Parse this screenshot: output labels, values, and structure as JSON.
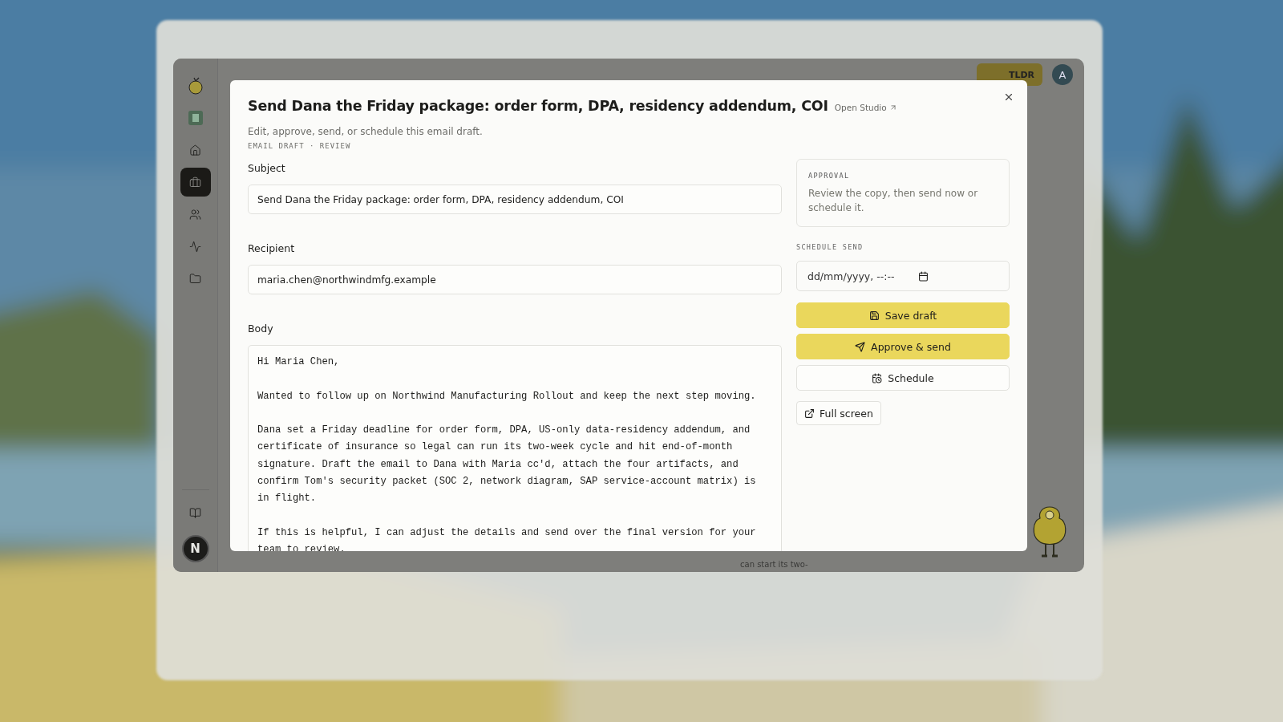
{
  "app": {
    "sidebar": {
      "top": [
        {
          "kind": "logo",
          "selected": false
        },
        {
          "kind": "badge",
          "selected": false
        },
        {
          "kind": "home",
          "selected": false
        },
        {
          "kind": "briefcase",
          "selected": true
        },
        {
          "kind": "users",
          "selected": false
        },
        {
          "kind": "activity",
          "selected": false
        },
        {
          "kind": "folder",
          "selected": false
        }
      ],
      "bottom": [
        {
          "kind": "book",
          "selected": false
        }
      ],
      "avatar": "N"
    },
    "header": {
      "button": "TLDR",
      "avatar": "A"
    },
    "behind_text": "can start its two-"
  },
  "modal": {
    "title": "Send Dana the Friday package: order form, DPA, residency addendum, COI",
    "link": "Open Studio",
    "subtitle": "Edit, approve, send, or schedule this email draft.",
    "meta": "EMAIL DRAFT · REVIEW",
    "fields": [
      {
        "label": "Subject",
        "value": "Send Dana the Friday package: order form, DPA, residency addendum, COI"
      },
      {
        "label": "Recipient",
        "value": "maria.chen@northwindmfg.example"
      }
    ],
    "body": {
      "label": "Body",
      "paragraphs": [
        "Hi Maria Chen,",
        "Wanted to follow up on Northwind Manufacturing Rollout and keep the next step moving.",
        "Dana set a Friday deadline for order form, DPA, US-only data-residency addendum, and certificate of insurance so legal can run its two-week cycle and hit end-of-month signature. Draft the email to Dana with Maria cc'd, attach the four artifacts, and confirm Tom's security packet (SOC 2, network diagram, SAP service-account matrix) is in flight.",
        "If this is helpful, I can adjust the details and send over the final version for your team to review."
      ]
    },
    "approval": {
      "heading": "APPROVAL",
      "text": "Review the copy, then send now or schedule it."
    },
    "schedule": {
      "label": "SCHEDULE SEND",
      "placeholder": "dd/mm/yyyy, --:--"
    },
    "actions": [
      {
        "kind": "save",
        "label": "Save draft",
        "primary": true
      },
      {
        "kind": "send",
        "label": "Approve & send",
        "primary": true
      },
      {
        "kind": "schedule",
        "label": "Schedule",
        "primary": false
      }
    ],
    "full_screen": "Full screen"
  }
}
